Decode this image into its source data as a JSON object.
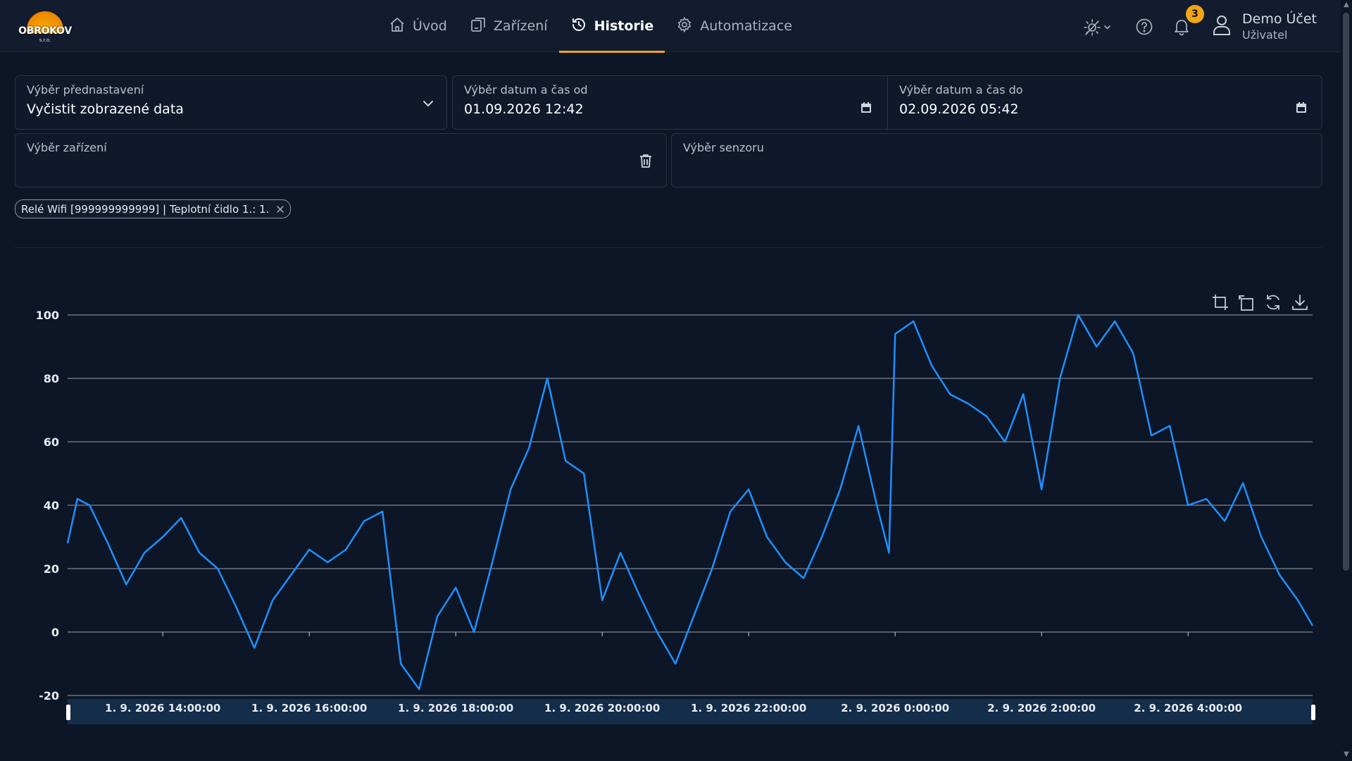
{
  "header": {
    "logo_text": "OBROKOV",
    "logo_sub": "s.r.o.",
    "nav": [
      {
        "label": "Úvod",
        "icon": "home-icon"
      },
      {
        "label": "Zařízení",
        "icon": "devices-icon"
      },
      {
        "label": "Historie",
        "icon": "history-icon",
        "active": true
      },
      {
        "label": "Automatizace",
        "icon": "gear-icon"
      }
    ],
    "notifications_count": "3",
    "user_name": "Demo Účet",
    "user_role": "Uživatel"
  },
  "filters": {
    "preset_label": "Výběr přednastavení",
    "preset_value": "Vyčistit zobrazené data",
    "from_label": "Výběr datum a čas od",
    "from_value": "01.09.2026 12:42",
    "to_label": "Výběr datum a čas do",
    "to_value": "02.09.2026 05:42",
    "device_label": "Výběr zařízení",
    "sensor_label": "Výběr senzoru"
  },
  "chip": {
    "label": "Relé Wifi [999999999999] | Teplotní čidlo 1.: 1."
  },
  "colors": {
    "accent": "#f0a41c",
    "series": "#1e90ff",
    "background": "#0d1627"
  },
  "chart_data": {
    "type": "line",
    "title": "",
    "xlabel": "",
    "ylabel": "",
    "ylim": [
      -20,
      100
    ],
    "y_ticks": [
      "100",
      "80",
      "60",
      "40",
      "20",
      "0",
      "-20"
    ],
    "x_range": [
      "1. 9. 2026 12:42:00",
      "2. 9. 2026 05:42:00"
    ],
    "x_ticks": [
      "1. 9. 2026 14:00:00",
      "1. 9. 2026 16:00:00",
      "1. 9. 2026 18:00:00",
      "1. 9. 2026 20:00:00",
      "1. 9. 2026 22:00:00",
      "2. 9. 2026 0:00:00",
      "2. 9. 2026 2:00:00",
      "2. 9. 2026 4:00:00"
    ],
    "grid": true,
    "series": [
      {
        "x": [
          "1. 9. 2026 12:42:00",
          "1. 9. 2026 12:50:00",
          "1. 9. 2026 13:00:00",
          "1. 9. 2026 13:15:00",
          "1. 9. 2026 13:30:00",
          "1. 9. 2026 13:45:00",
          "1. 9. 2026 14:00:00",
          "1. 9. 2026 14:15:00",
          "1. 9. 2026 14:30:00",
          "1. 9. 2026 14:45:00",
          "1. 9. 2026 15:00:00",
          "1. 9. 2026 15:15:00",
          "1. 9. 2026 15:30:00",
          "1. 9. 2026 15:45:00",
          "1. 9. 2026 16:00:00",
          "1. 9. 2026 16:15:00",
          "1. 9. 2026 16:30:00",
          "1. 9. 2026 16:45:00",
          "1. 9. 2026 17:00:00",
          "1. 9. 2026 17:15:00",
          "1. 9. 2026 17:30:00",
          "1. 9. 2026 17:45:00",
          "1. 9. 2026 18:00:00",
          "1. 9. 2026 18:15:00",
          "1. 9. 2026 18:30:00",
          "1. 9. 2026 18:45:00",
          "1. 9. 2026 19:00:00",
          "1. 9. 2026 19:15:00",
          "1. 9. 2026 19:30:00",
          "1. 9. 2026 19:45:00",
          "1. 9. 2026 20:00:00",
          "1. 9. 2026 20:15:00",
          "1. 9. 2026 20:30:00",
          "1. 9. 2026 20:45:00",
          "1. 9. 2026 21:00:00",
          "1. 9. 2026 21:15:00",
          "1. 9. 2026 21:30:00",
          "1. 9. 2026 21:45:00",
          "1. 9. 2026 22:00:00",
          "1. 9. 2026 22:15:00",
          "1. 9. 2026 22:30:00",
          "1. 9. 2026 22:45:00",
          "1. 9. 2026 23:00:00",
          "1. 9. 2026 23:15:00",
          "1. 9. 2026 23:30:00",
          "1. 9. 2026 23:45:00",
          "1. 9. 2026 23:55:00",
          "2. 9. 2026 0:00:00",
          "2. 9. 2026 0:15:00",
          "2. 9. 2026 0:30:00",
          "2. 9. 2026 0:45:00",
          "2. 9. 2026 1:00:00",
          "2. 9. 2026 1:15:00",
          "2. 9. 2026 1:30:00",
          "2. 9. 2026 1:45:00",
          "2. 9. 2026 2:00:00",
          "2. 9. 2026 2:15:00",
          "2. 9. 2026 2:30:00",
          "2. 9. 2026 2:45:00",
          "2. 9. 2026 3:00:00",
          "2. 9. 2026 3:15:00",
          "2. 9. 2026 3:30:00",
          "2. 9. 2026 3:45:00",
          "2. 9. 2026 4:00:00",
          "2. 9. 2026 4:15:00",
          "2. 9. 2026 4:30:00",
          "2. 9. 2026 4:45:00",
          "2. 9. 2026 5:00:00",
          "2. 9. 2026 5:15:00",
          "2. 9. 2026 5:30:00",
          "2. 9. 2026 5:42:00"
        ],
        "values": [
          28,
          42,
          40,
          28,
          15,
          25,
          30,
          36,
          25,
          20,
          8,
          -5,
          10,
          18,
          26,
          22,
          26,
          35,
          38,
          -10,
          -18,
          5,
          14,
          0,
          22,
          45,
          58,
          80,
          54,
          50,
          10,
          25,
          12,
          0,
          -10,
          5,
          20,
          38,
          45,
          30,
          22,
          17,
          30,
          45,
          65,
          40,
          25,
          94,
          98,
          84,
          75,
          72,
          68,
          60,
          75,
          45,
          80,
          100,
          90,
          98,
          88,
          62,
          65,
          40,
          42,
          35,
          47,
          30,
          18,
          10,
          2
        ]
      }
    ]
  }
}
